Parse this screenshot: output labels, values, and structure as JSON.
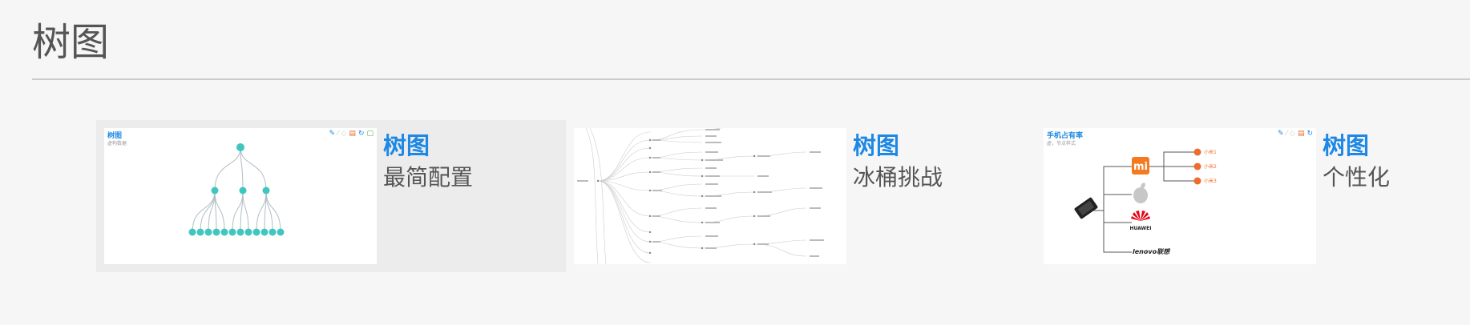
{
  "page": {
    "title": "树图"
  },
  "cards": [
    {
      "title": "树图",
      "subtitle": "最简配置",
      "thumb_title": "树图",
      "thumb_subtitle": "虚构数据",
      "active": true
    },
    {
      "title": "树图",
      "subtitle": "冰桶挑战",
      "active": false
    },
    {
      "title": "树图",
      "subtitle": "个性化",
      "thumb_title": "手机占有率",
      "thumb_subtitle": "虚，节点样式",
      "brand_labels": [
        "小米1",
        "小米2",
        "小米3"
      ],
      "huawei_label": "HUAWEI",
      "lenovo_label": "lenovo联想",
      "active": false
    }
  ],
  "toolbar_icons": [
    "mark-icon",
    "edit-icon",
    "refresh-icon",
    "save-icon",
    "restore-icon",
    "data-icon"
  ],
  "colors": {
    "accent": "#1e88e5",
    "node_teal": "#3fc6c0",
    "node_orange": "#ef6c2a",
    "huawei_red": "#e60012",
    "mi_orange": "#f47a20"
  }
}
